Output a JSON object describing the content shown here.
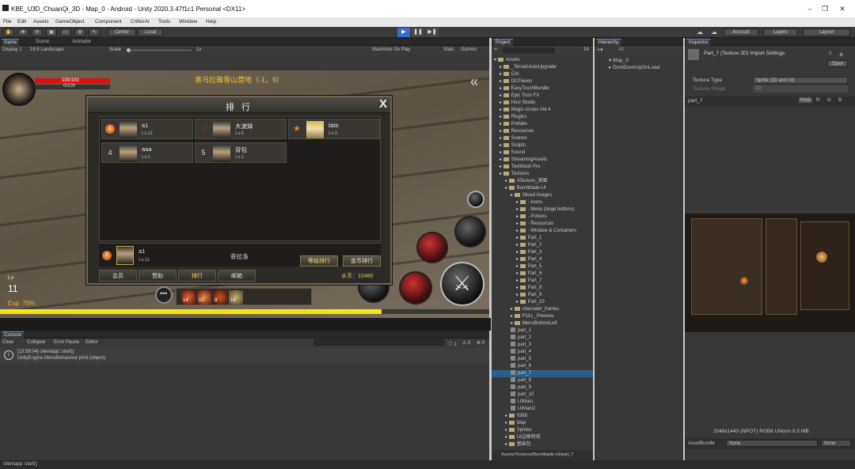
{
  "window": {
    "title": "KBE_U3D_ChuanQi_3D - Map_0 - Android - Unity 2020.3.47f1c1 Personal <DX11>"
  },
  "menu": [
    "File",
    "Edit",
    "Assets",
    "GameObject",
    "Component",
    "CritterAI",
    "Tools",
    "Window",
    "Help"
  ],
  "toolbar": {
    "pivot": "Center",
    "space": "Local",
    "account": "Account",
    "layers": "Layers",
    "layout": "Layout"
  },
  "game_tabs": [
    "Game",
    "Scene",
    "Animator"
  ],
  "game_options": {
    "display": "Display 1",
    "aspect": "18:9 Landscape",
    "scale_label": "Scale",
    "scale_value": "1x",
    "maximize": "Maximize On Play",
    "stats": "Stats",
    "gizmos": "Gizmos"
  },
  "hud": {
    "hp": "100/100",
    "mp": "0/100",
    "location": "喜马拉雅雪山营地（-1，9）",
    "level_label": "Lv",
    "level": "11",
    "exp": "Exp: 78%",
    "exp_fill": 0.78
  },
  "rank": {
    "title": "排 行",
    "close": "X",
    "entries": [
      {
        "rank": "1",
        "name": "a1",
        "lv": "Lv.11"
      },
      {
        "rank": "2",
        "name": "大波妹",
        "lv": "Lv.4"
      },
      {
        "rank": "3",
        "name": "bbb",
        "lv": "Lv.3"
      },
      {
        "rank": "4",
        "name": "aaa",
        "lv": "Lv.1"
      },
      {
        "rank": "5",
        "name": "背包",
        "lv": "Lv.1"
      }
    ],
    "self": {
      "name": "a1",
      "lv": "Lv.11",
      "guild": "菲拉洛"
    },
    "level_rank_btn": "等级排行",
    "gold_rank_btn": "金币排行",
    "nav": [
      "会员",
      "赞助",
      "排行",
      "邮箱"
    ],
    "coins": "水币：10480"
  },
  "skills_bar": {
    "counts": [
      "14",
      "10",
      "8",
      "14"
    ]
  },
  "console": {
    "tab": "Console",
    "buttons": [
      "Clear",
      "Collapse",
      "Error Pause",
      "Editor"
    ],
    "counts": [
      "1",
      "0",
      "0"
    ],
    "log_line1": "[13:58:04] clientapp::start()",
    "log_line2": "UnityEngine.MonoBehaviour:print (object)"
  },
  "project": {
    "tab": "Project",
    "count": "14",
    "root": "Assets",
    "items": [
      {
        "d": 1,
        "t": "_TerrainAutoUpgrade"
      },
      {
        "d": 1,
        "t": "CAI"
      },
      {
        "d": 1,
        "t": "DOTween"
      },
      {
        "d": 1,
        "t": "EasyTouchBundle"
      },
      {
        "d": 1,
        "t": "Epic Toon FX"
      },
      {
        "d": 1,
        "t": "Hovl Studio"
      },
      {
        "d": 1,
        "t": "Magic circles Vol 4"
      },
      {
        "d": 1,
        "t": "Plugins"
      },
      {
        "d": 1,
        "t": "Prefabs"
      },
      {
        "d": 1,
        "t": "Resources"
      },
      {
        "d": 1,
        "t": "Scenes"
      },
      {
        "d": 1,
        "t": "Scripts"
      },
      {
        "d": 1,
        "t": "Sound"
      },
      {
        "d": 1,
        "t": "StreamingAssets"
      },
      {
        "d": 1,
        "t": "TextMesh Pro"
      },
      {
        "d": 1,
        "t": "Textures"
      },
      {
        "d": 2,
        "t": "ATexture_测面"
      },
      {
        "d": 2,
        "t": "Burntblade-UI"
      },
      {
        "d": 3,
        "t": "Sliced Images"
      },
      {
        "d": 4,
        "t": "- Icons"
      },
      {
        "d": 4,
        "t": "- Menu (large buttons)"
      },
      {
        "d": 4,
        "t": "- Potions"
      },
      {
        "d": 4,
        "t": "- Resources"
      },
      {
        "d": 4,
        "t": "- Window & Containers"
      },
      {
        "d": 4,
        "t": "Part_1"
      },
      {
        "d": 4,
        "t": "Part_2"
      },
      {
        "d": 4,
        "t": "Part_3"
      },
      {
        "d": 4,
        "t": "Part_4"
      },
      {
        "d": 4,
        "t": "Part_5"
      },
      {
        "d": 4,
        "t": "Part_6"
      },
      {
        "d": 4,
        "t": "Part_7"
      },
      {
        "d": 4,
        "t": "Part_8"
      },
      {
        "d": 4,
        "t": "Part_9"
      },
      {
        "d": 4,
        "t": "Part_10"
      },
      {
        "d": 3,
        "t": "charcater_frames"
      },
      {
        "d": 3,
        "t": "FULL_Preview"
      },
      {
        "d": 3,
        "t": "MenuBottomLeft"
      },
      {
        "d": 3,
        "t": "part_1",
        "f": 1
      },
      {
        "d": 3,
        "t": "part_2",
        "f": 1
      },
      {
        "d": 3,
        "t": "part_3",
        "f": 1
      },
      {
        "d": 3,
        "t": "part_4",
        "f": 1
      },
      {
        "d": 3,
        "t": "part_5",
        "f": 1
      },
      {
        "d": 3,
        "t": "part_6",
        "f": 1
      },
      {
        "d": 3,
        "t": "part_7",
        "f": 1,
        "sel": 1
      },
      {
        "d": 3,
        "t": "part_8",
        "f": 1
      },
      {
        "d": 3,
        "t": "part_9",
        "f": 1
      },
      {
        "d": 3,
        "t": "part_10",
        "f": 1
      },
      {
        "d": 3,
        "t": "UIMain",
        "f": 1
      },
      {
        "d": 3,
        "t": "UIMain2",
        "f": 1
      },
      {
        "d": 2,
        "t": "0368"
      },
      {
        "d": 2,
        "t": "Map"
      },
      {
        "d": 2,
        "t": "Sprites"
      },
      {
        "d": 2,
        "t": "UI边框特效"
      },
      {
        "d": 2,
        "t": "基础包"
      }
    ],
    "path": "Assets/Textures/Burntblade-UI/part_7"
  },
  "hierarchy": {
    "tab": "Hierarchy",
    "search": "All",
    "items": [
      "Map_0",
      "DontDestroyOnLoad"
    ]
  },
  "inspector": {
    "tab": "Inspector",
    "title": "Part_7 (Texture 2D) Import Settings",
    "open": "Open",
    "texture_type_label": "Texture Type",
    "texture_type": "Sprite (2D and UI)",
    "texture_shape_label": "Texture Shape",
    "texture_shape": "2D",
    "asset_name": "part_7",
    "channels": [
      "RGB",
      "R",
      "G",
      "B"
    ],
    "dims": "2048x1443 (NPOT)  RGB8 UNorm   8.5 MB",
    "assetbundle_label": "AssetBundle",
    "assetbundle": "None",
    "variant": "None"
  },
  "status": "clientapp::start()"
}
